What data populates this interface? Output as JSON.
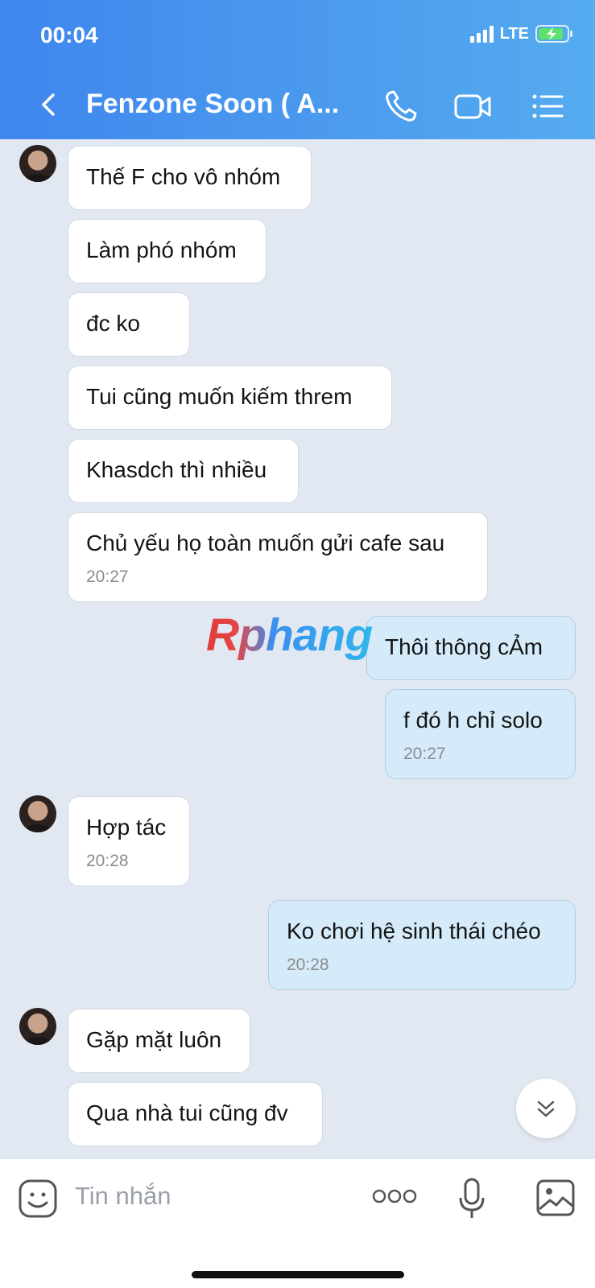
{
  "status_bar": {
    "time": "00:04",
    "network": "LTE"
  },
  "header": {
    "title": "Fenzone Soon ( A..."
  },
  "watermark": {
    "text": "Rphang"
  },
  "messages": [
    {
      "sender": "them",
      "text": "Thế F cho vô nhóm"
    },
    {
      "sender": "them",
      "text": "Làm phó nhóm"
    },
    {
      "sender": "them",
      "text": "đc ko"
    },
    {
      "sender": "them",
      "text": "Tui cũng muốn kiếm threm"
    },
    {
      "sender": "them",
      "text": "Khasdch thì nhiều"
    },
    {
      "sender": "them",
      "text": "Chủ yếu họ toàn muốn gửi cafe sau",
      "time": "20:27"
    },
    {
      "sender": "me",
      "text": "Thôi thông cẢm"
    },
    {
      "sender": "me",
      "text": "f đó h chỉ solo",
      "time": "20:27"
    },
    {
      "sender": "them",
      "text": "Hợp tác",
      "time": "20:28"
    },
    {
      "sender": "me",
      "text": "Ko chơi hệ sinh thái chéo",
      "time": "20:28"
    },
    {
      "sender": "them",
      "text": "Gặp mặt luôn"
    },
    {
      "sender": "them",
      "text": "Qua nhà tui cũng đv"
    }
  ],
  "input": {
    "placeholder": "Tin nhắn"
  },
  "icons": {
    "back": "chevron-left-icon",
    "call": "phone-icon",
    "video": "video-camera-icon",
    "menu": "list-icon",
    "sticker": "sticker-icon",
    "more": "more-dots-icon",
    "mic": "microphone-icon",
    "image": "image-icon",
    "scroll": "double-chevron-down-icon"
  },
  "colors": {
    "header_start": "#3f86ee",
    "header_end": "#55abef",
    "chat_bg": "#e2e8f1",
    "my_bubble": "#d5ebfa"
  }
}
